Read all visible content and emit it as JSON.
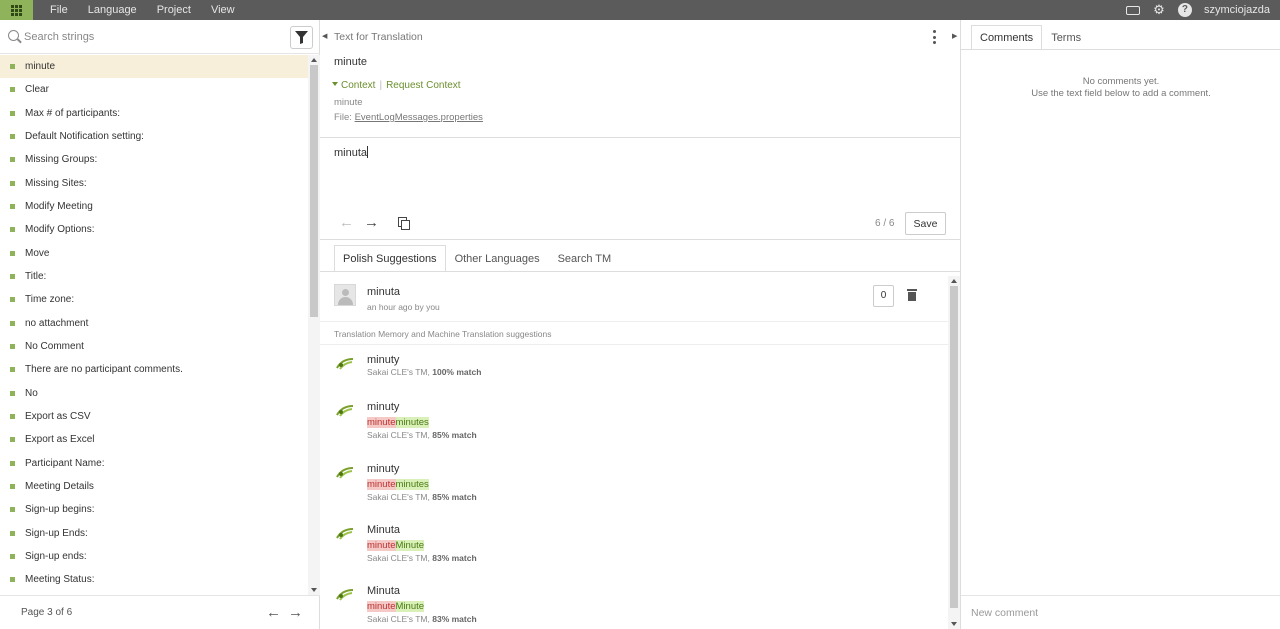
{
  "menu": [
    "File",
    "Language",
    "Project",
    "View"
  ],
  "user": "szymciojazda",
  "search": {
    "placeholder": "Search strings"
  },
  "strings": [
    "minute",
    "Clear",
    "Max # of participants:",
    "Default Notification setting:",
    "Missing Groups:",
    "Missing Sites:",
    "Modify Meeting",
    "Modify Options:",
    "Move",
    "Title:",
    "Time zone:",
    "no attachment",
    "No Comment",
    "There are no participant comments.",
    "No",
    "Export as CSV",
    "Export as Excel",
    "Participant Name:",
    "Meeting Details",
    "Sign-up begins:",
    "Sign-up Ends:",
    "Sign-up ends:",
    "Meeting Status:"
  ],
  "pager": {
    "label": "Page 3 of 6"
  },
  "editor": {
    "title": "Text for Translation",
    "source": "minute",
    "context_label": "Context",
    "request_context": "Request Context",
    "context_key": "minute",
    "file_label": "File:",
    "file_name": "EventLogMessages.properties",
    "translation": "minuta",
    "counter": "6 / 6",
    "save": "Save"
  },
  "suggestions": {
    "tabs": [
      "Polish Suggestions",
      "Other Languages",
      "Search TM"
    ],
    "own": {
      "text": "minuta",
      "meta": "an hour ago by you",
      "votes": "0"
    },
    "tm_header": "Translation Memory and Machine Translation suggestions",
    "items": [
      {
        "text": "minuty",
        "del": "",
        "ins": "",
        "source": "Sakai CLE's TM,",
        "match": "100% match"
      },
      {
        "text": "minuty",
        "del": "minute",
        "ins": "minutes",
        "source": "Sakai CLE's TM,",
        "match": "85% match"
      },
      {
        "text": "minuty",
        "del": "minute",
        "ins": "minutes",
        "source": "Sakai CLE's TM,",
        "match": "85% match"
      },
      {
        "text": "Minuta",
        "del": "minute",
        "ins": "Minute",
        "source": "Sakai CLE's TM,",
        "match": "83% match"
      },
      {
        "text": "Minuta",
        "del": "minute",
        "ins": "Minute",
        "source": "Sakai CLE's TM,",
        "match": "83% match"
      }
    ]
  },
  "comments": {
    "tabs": [
      "Comments",
      "Terms"
    ],
    "empty_line1": "No comments yet.",
    "empty_line2": "Use the text field below to add a comment.",
    "placeholder": "New comment"
  },
  "colors": {
    "accent": "#8fb35a",
    "topbar": "#5b5b5b",
    "selected_row": "#f7efd9"
  }
}
